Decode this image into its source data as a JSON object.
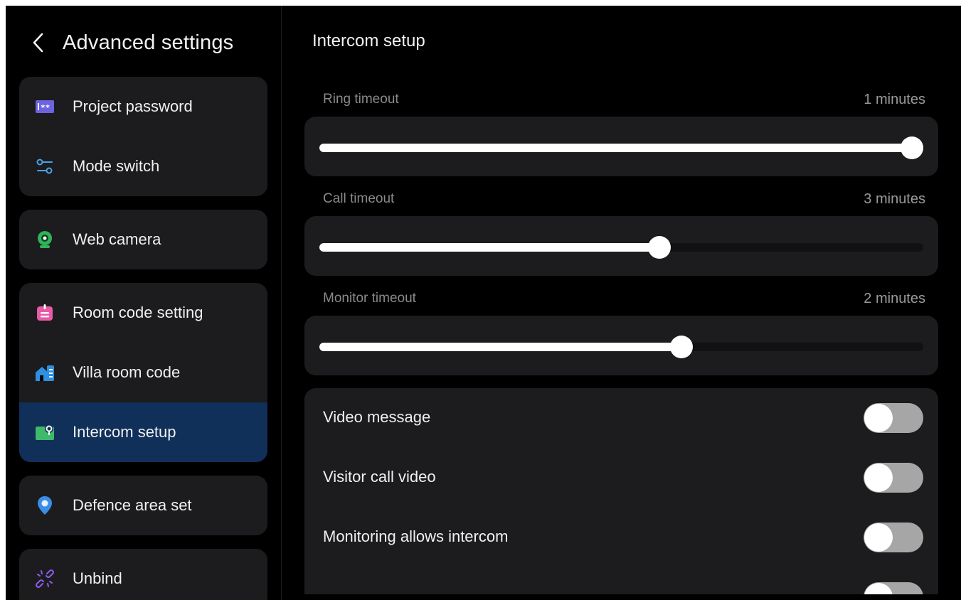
{
  "sidebar": {
    "title": "Advanced settings",
    "groups": [
      {
        "items": [
          {
            "label": "Project password",
            "icon": "password-icon"
          },
          {
            "label": "Mode switch",
            "icon": "mode-switch-icon"
          }
        ]
      },
      {
        "items": [
          {
            "label": "Web camera",
            "icon": "web-camera-icon"
          }
        ]
      },
      {
        "items": [
          {
            "label": "Room code setting",
            "icon": "room-code-icon"
          },
          {
            "label": "Villa room code",
            "icon": "villa-icon"
          },
          {
            "label": "Intercom setup",
            "icon": "intercom-icon",
            "active": true
          }
        ]
      },
      {
        "items": [
          {
            "label": "Defence area set",
            "icon": "location-pin-icon"
          }
        ]
      },
      {
        "items": [
          {
            "label": "Unbind",
            "icon": "unlink-icon"
          }
        ]
      }
    ]
  },
  "main": {
    "title": "Intercom setup",
    "sliders": [
      {
        "label": "Ring timeout",
        "value": "1 minutes",
        "level": 1.0
      },
      {
        "label": "Call timeout",
        "value": "3 minutes",
        "level": 0.5625
      },
      {
        "label": "Monitor timeout",
        "value": "2 minutes",
        "level": 0.6
      }
    ],
    "toggles": [
      {
        "label": "Video message",
        "on": false
      },
      {
        "label": "Visitor call video",
        "on": false
      },
      {
        "label": "Monitoring allows intercom",
        "on": false
      },
      {
        "label": "",
        "on": false
      }
    ]
  },
  "colors": {
    "background": "#000000",
    "card": "#1c1c1e",
    "active_item": "#10305a",
    "toggle_off": "#a6a6a6"
  }
}
